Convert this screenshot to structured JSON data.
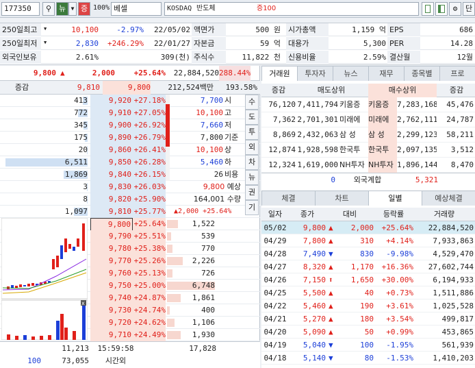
{
  "top": {
    "code": "177350",
    "market": "KOSDAQ",
    "sector": "반도체",
    "margin": "증100",
    "zoom": "100%",
    "name": "베셀",
    "btn_chart": "뉴",
    "btn_pct": "증",
    "btn_single": "단"
  },
  "info": [
    {
      "l1": "250일최고",
      "v1": "10,100",
      "p1": "-2.97%",
      "d1": "22/05/02",
      "l2": "액면가",
      "v2": "500 원",
      "l3": "시가총액",
      "v3": "1,159 억",
      "l4": "EPS",
      "v4": "686"
    },
    {
      "l1": "250일최저",
      "v1": "2,830",
      "p1": "+246.29%",
      "d1": "22/01/27",
      "l2": "자본금",
      "v2": "59 억",
      "l3": "대용가",
      "v3": "5,300",
      "l4": "PER",
      "v4": "14.28"
    },
    {
      "l1": "외국인보유",
      "v1": "2.61%",
      "p1": "",
      "d1": "309(천)",
      "l2": "주식수",
      "v2": "11,822 천",
      "l3": "신용비율",
      "v3": "2.59%",
      "l4": "결산월",
      "v4": "12월"
    }
  ],
  "quote": {
    "price": "9,800",
    "arrow": "▲",
    "change": "2,000",
    "rate": "+25.64%",
    "volume": "22,884,520",
    "vol_rate": "288.44%"
  },
  "quote2": {
    "label": "증감",
    "ask": "9,810",
    "bid": "9,800",
    "amount": "212,524백만",
    "pct": "193.58%"
  },
  "asks": [
    {
      "qty": "413",
      "price": "9,920",
      "rate": "+27.18%"
    },
    {
      "qty": "772",
      "price": "9,910",
      "rate": "+27.05%"
    },
    {
      "qty": "345",
      "price": "9,900",
      "rate": "+26.92%"
    },
    {
      "qty": "175",
      "price": "9,890",
      "rate": "+26.79%"
    },
    {
      "qty": "20",
      "price": "9,860",
      "rate": "+26.41%"
    },
    {
      "qty": "6,511",
      "price": "9,850",
      "rate": "+26.28%"
    },
    {
      "qty": "1,869",
      "price": "9,840",
      "rate": "+26.15%"
    },
    {
      "qty": "3",
      "price": "9,830",
      "rate": "+26.03%"
    },
    {
      "qty": "8",
      "price": "9,820",
      "rate": "+25.90%"
    },
    {
      "qty": "1,097",
      "price": "9,810",
      "rate": "+25.77%"
    }
  ],
  "bids": [
    {
      "qty": "1,522",
      "price": "9,800",
      "rate": "+25.64%"
    },
    {
      "qty": "539",
      "price": "9,790",
      "rate": "+25.51%"
    },
    {
      "qty": "770",
      "price": "9,780",
      "rate": "+25.38%"
    },
    {
      "qty": "2,226",
      "price": "9,770",
      "rate": "+25.26%"
    },
    {
      "qty": "726",
      "price": "9,760",
      "rate": "+25.13%"
    },
    {
      "qty": "6,748",
      "price": "9,750",
      "rate": "+25.00%"
    },
    {
      "qty": "1,861",
      "price": "9,740",
      "rate": "+24.87%"
    },
    {
      "qty": "400",
      "price": "9,730",
      "rate": "+24.74%"
    },
    {
      "qty": "1,106",
      "price": "9,720",
      "rate": "+24.62%"
    },
    {
      "qty": "1,930",
      "price": "9,710",
      "rate": "+24.49%"
    }
  ],
  "ask_bar_pct": [
    6,
    12,
    5,
    3,
    1,
    100,
    29,
    1,
    1,
    17
  ],
  "bid_bar_pct": [
    23,
    8,
    11,
    33,
    11,
    100,
    28,
    6,
    16,
    29
  ],
  "ohlc": [
    {
      "v": "7,700",
      "l": "시"
    },
    {
      "v": "10,100",
      "l": "고"
    },
    {
      "v": "7,660",
      "l": "저"
    },
    {
      "v": "7,800",
      "l": "기준"
    },
    {
      "v": "10,100",
      "l": "상"
    },
    {
      "v": "5,460",
      "l": "하"
    },
    {
      "v": "26",
      "l": "비용"
    }
  ],
  "expect": {
    "price": "9,800",
    "price_l": "예상",
    "qty": "164,001",
    "qty_l": "수량",
    "arrow": "▲",
    "chg": "2,000",
    "rate": "+25.64%"
  },
  "vtabs": [
    "수",
    "도",
    "투",
    "외",
    "차",
    "뉴",
    "권",
    "기"
  ],
  "bottom": {
    "ask_total": "11,213",
    "time": "15:59:58",
    "bid_total": "17,828",
    "lbl": "100",
    "after": "73,055",
    "after_l": "시간외"
  },
  "tabs1": [
    "거래원",
    "투자자",
    "뉴스",
    "재무",
    "종목별",
    "프로"
  ],
  "broker": {
    "h_chg": "증감",
    "h_sell": "매도상위",
    "h_buy": "매수상위",
    "h_chg2": "증감",
    "rows": [
      {
        "c1": "76,120",
        "s": "7,411,794",
        "sn": "키움증",
        "bn": "키움증",
        "b": "7,283,168",
        "c2": "45,476"
      },
      {
        "c1": "7,362",
        "s": "2,701,301",
        "sn": "미래에",
        "bn": "미래에",
        "b": "2,762,111",
        "c2": "24,787"
      },
      {
        "c1": "8,869",
        "s": "2,432,063",
        "sn": "삼 성",
        "bn": "삼 성",
        "b": "2,299,123",
        "c2": "58,211"
      },
      {
        "c1": "12,874",
        "s": "1,928,598",
        "sn": "한국투",
        "bn": "한국투",
        "b": "2,097,135",
        "c2": "3,512"
      },
      {
        "c1": "12,324",
        "s": "1,619,000",
        "sn": "NH투자",
        "bn": "NH투자",
        "b": "1,896,144",
        "c2": "8,470"
      }
    ],
    "foreign": {
      "c1": "0",
      "label": "외국계합",
      "c2": "5,321"
    }
  },
  "tabs2": [
    "체결",
    "차트",
    "일별",
    "예상체결"
  ],
  "daily": {
    "h": [
      "일자",
      "종가",
      "대비",
      "등락률",
      "거래량"
    ],
    "rows": [
      {
        "d": "05/02",
        "p": "9,800",
        "dir": "up",
        "c": "2,000",
        "r": "+25.64%",
        "v": "22,884,520"
      },
      {
        "d": "04/29",
        "p": "7,800",
        "dir": "up",
        "c": "310",
        "r": "+4.14%",
        "v": "7,933,863"
      },
      {
        "d": "04/28",
        "p": "7,490",
        "dir": "dn",
        "c": "830",
        "r": "-9.98%",
        "v": "4,529,470"
      },
      {
        "d": "04/27",
        "p": "8,320",
        "dir": "up",
        "c": "1,170",
        "r": "+16.36%",
        "v": "27,602,744"
      },
      {
        "d": "04/26",
        "p": "7,150",
        "dir": "lim",
        "c": "1,650",
        "r": "+30.00%",
        "v": "6,194,933"
      },
      {
        "d": "04/25",
        "p": "5,500",
        "dir": "up",
        "c": "40",
        "r": "+0.73%",
        "v": "1,511,886"
      },
      {
        "d": "04/22",
        "p": "5,460",
        "dir": "up",
        "c": "190",
        "r": "+3.61%",
        "v": "1,025,528"
      },
      {
        "d": "04/21",
        "p": "5,270",
        "dir": "up",
        "c": "180",
        "r": "+3.54%",
        "v": "499,817"
      },
      {
        "d": "04/20",
        "p": "5,090",
        "dir": "up",
        "c": "50",
        "r": "+0.99%",
        "v": "453,865"
      },
      {
        "d": "04/19",
        "p": "5,040",
        "dir": "dn",
        "c": "100",
        "r": "-1.95%",
        "v": "561,939"
      },
      {
        "d": "04/18",
        "p": "5,140",
        "dir": "dn",
        "c": "80",
        "r": "-1.53%",
        "v": "1,410,203"
      }
    ]
  },
  "colors": {
    "up": "#e0201a",
    "down": "#1c3fd8",
    "accent": "#2f6fc0"
  }
}
